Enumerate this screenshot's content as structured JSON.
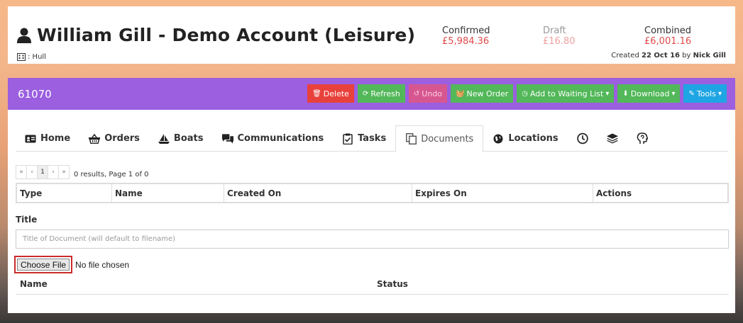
{
  "account": {
    "title": "William Gill - Demo Account (Leisure)",
    "location": ": Hull",
    "created_prefix": "Created ",
    "created_date": "22 Oct 16",
    "created_by_prefix": " by ",
    "created_by": "Nick Gill"
  },
  "stats": {
    "confirmed_label": "Confirmed",
    "confirmed_value": "£5,984.36",
    "draft_label": "Draft",
    "draft_value": "£16.80",
    "combined_label": "Combined",
    "combined_value": "£6,001.16"
  },
  "panel": {
    "id": "61070",
    "buttons": {
      "delete": "Delete",
      "refresh": "Refresh",
      "undo": "Undo",
      "new_order": "New Order",
      "waiting_list": "Add to Waiting List",
      "download": "Download",
      "tools": "Tools"
    }
  },
  "tabs": {
    "home": "Home",
    "orders": "Orders",
    "boats": "Boats",
    "communications": "Communications",
    "tasks": "Tasks",
    "documents": "Documents",
    "locations": "Locations"
  },
  "pager": {
    "first": "«",
    "prev": "‹",
    "page": "1",
    "next": "›",
    "last": "»",
    "info": "0 results, Page 1 of 0"
  },
  "table": {
    "columns": [
      "Type",
      "Name",
      "Created On",
      "Expires On",
      "Actions"
    ]
  },
  "form": {
    "title_label": "Title",
    "title_placeholder": "Title of Document (will default to filename)",
    "choose_file": "Choose File",
    "no_file": "No file chosen"
  },
  "upload_list": {
    "name_col": "Name",
    "status_col": "Status"
  },
  "colors": {
    "panel_header": "#9b5fe0",
    "danger": "#e8413c",
    "success": "#52b859",
    "info": "#1fa5e3"
  }
}
